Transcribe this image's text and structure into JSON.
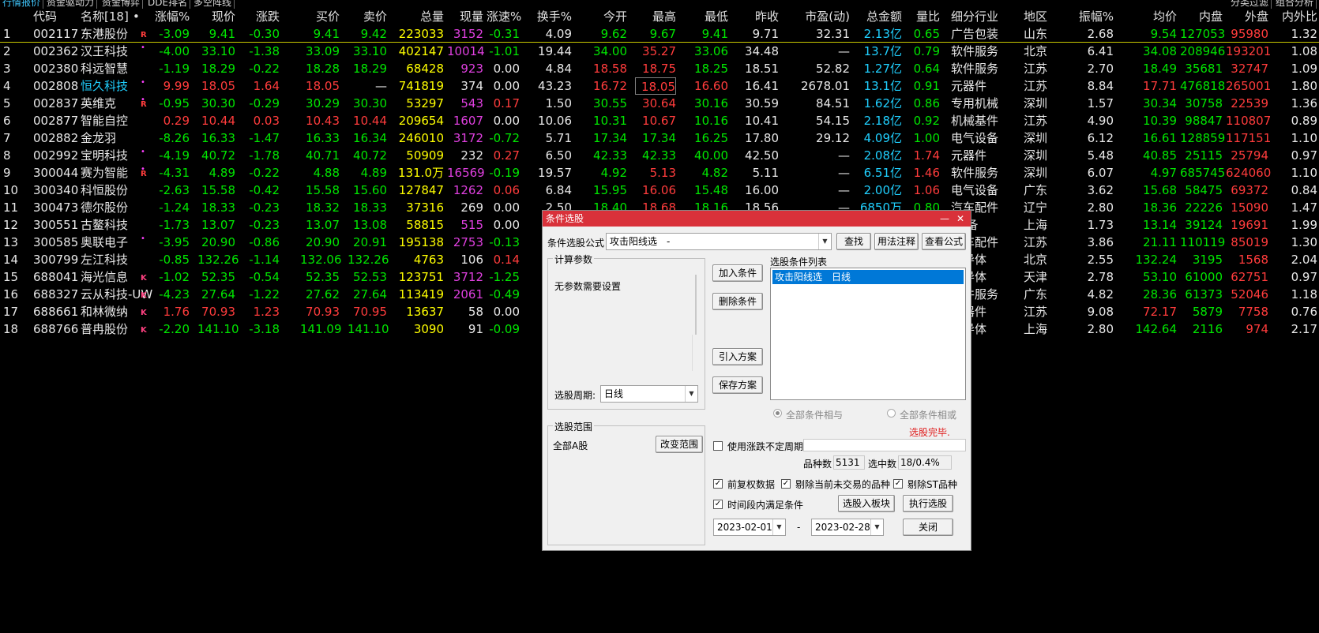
{
  "top_tabs": [
    {
      "label": "行情报价"
    },
    {
      "label": "资金驱动力"
    },
    {
      "label": "资金博弈"
    },
    {
      "label": "DDE排名"
    },
    {
      "label": "多空阵线"
    },
    {
      "label": "分类过滤"
    },
    {
      "label": "组合分析"
    }
  ],
  "table": {
    "headers": [
      "代码",
      "名称[18]",
      "•",
      "涨幅%",
      "现价",
      "涨跌",
      "买价",
      "卖价",
      "总量",
      "现量",
      "涨速%",
      "换手%",
      "今开",
      "最高",
      "最低",
      "昨收",
      "市盈(动)",
      "总金额",
      "量比",
      "细分行业",
      "地区",
      "振幅%",
      "均价",
      "内盘",
      "外盘",
      "内外比"
    ],
    "rows": [
      {
        "idx": "1",
        "code": "002117",
        "name": "东港股份",
        "dot": "",
        "flag": "R",
        "pct": "-3.09",
        "price": "9.41",
        "chg": "-0.30",
        "bid": "9.41",
        "ask": "9.42",
        "vol": "223033",
        "cur": "3152",
        "speed": "-0.31",
        "turn": "4.09",
        "open": "9.62",
        "high": "9.67",
        "low": "9.41",
        "prev": "9.71",
        "pe": "32.31",
        "amount": "2.13亿",
        "vr": "0.65",
        "industry": "广告包装",
        "region": "山东",
        "amp": "2.68",
        "avg": "9.54",
        "inner": "127053",
        "outer": "95980",
        "io": "1.32"
      },
      {
        "idx": "2",
        "code": "002362",
        "name": "汉王科技",
        "dot": "•",
        "flag": "",
        "pct": "-4.00",
        "price": "33.10",
        "chg": "-1.38",
        "bid": "33.09",
        "ask": "33.10",
        "vol": "402147",
        "cur": "10014",
        "speed": "-1.01",
        "turn": "19.44",
        "open": "34.00",
        "high": "35.27",
        "low": "33.06",
        "prev": "34.48",
        "pe": "—",
        "amount": "13.7亿",
        "vr": "0.79",
        "industry": "软件服务",
        "region": "北京",
        "amp": "6.41",
        "avg": "34.08",
        "inner": "208946",
        "outer": "193201",
        "io": "1.08"
      },
      {
        "idx": "3",
        "code": "002380",
        "name": "科远智慧",
        "dot": "",
        "flag": "",
        "pct": "-1.19",
        "price": "18.29",
        "chg": "-0.22",
        "bid": "18.28",
        "ask": "18.29",
        "vol": "68428",
        "cur": "923",
        "speed": "0.00",
        "turn": "4.84",
        "open": "18.58",
        "high": "18.75",
        "low": "18.25",
        "prev": "18.51",
        "pe": "52.82",
        "amount": "1.27亿",
        "vr": "0.64",
        "industry": "软件服务",
        "region": "江苏",
        "amp": "2.70",
        "avg": "18.49",
        "inner": "35681",
        "outer": "32747",
        "io": "1.09"
      },
      {
        "idx": "4",
        "code": "002808",
        "name": "恒久科技",
        "dot": "•",
        "flag": "",
        "pct": "9.99",
        "price": "18.05",
        "chg": "1.64",
        "bid": "18.05",
        "ask": "—",
        "vol": "741819",
        "cur": "374",
        "speed": "0.00",
        "turn": "43.23",
        "open": "16.72",
        "high": "18.05",
        "low": "16.60",
        "prev": "16.41",
        "pe": "2678.01",
        "amount": "13.1亿",
        "vr": "0.91",
        "industry": "元器件",
        "region": "江苏",
        "amp": "8.84",
        "avg": "17.71",
        "inner": "476818",
        "outer": "265001",
        "io": "1.80"
      },
      {
        "idx": "5",
        "code": "002837",
        "name": "英维克",
        "dot": "•",
        "flag": "R",
        "pct": "-0.95",
        "price": "30.30",
        "chg": "-0.29",
        "bid": "30.29",
        "ask": "30.30",
        "vol": "53297",
        "cur": "543",
        "speed": "0.17",
        "turn": "1.50",
        "open": "30.55",
        "high": "30.64",
        "low": "30.16",
        "prev": "30.59",
        "pe": "84.51",
        "amount": "1.62亿",
        "vr": "0.86",
        "industry": "专用机械",
        "region": "深圳",
        "amp": "1.57",
        "avg": "30.34",
        "inner": "30758",
        "outer": "22539",
        "io": "1.36"
      },
      {
        "idx": "6",
        "code": "002877",
        "name": "智能自控",
        "dot": "",
        "flag": "",
        "pct": "0.29",
        "price": "10.44",
        "chg": "0.03",
        "bid": "10.43",
        "ask": "10.44",
        "vol": "209654",
        "cur": "1607",
        "speed": "0.00",
        "turn": "10.06",
        "open": "10.31",
        "high": "10.67",
        "low": "10.16",
        "prev": "10.41",
        "pe": "54.15",
        "amount": "2.18亿",
        "vr": "0.92",
        "industry": "机械基件",
        "region": "江苏",
        "amp": "4.90",
        "avg": "10.39",
        "inner": "98847",
        "outer": "110807",
        "io": "0.89"
      },
      {
        "idx": "7",
        "code": "002882",
        "name": "金龙羽",
        "dot": "",
        "flag": "",
        "pct": "-8.26",
        "price": "16.33",
        "chg": "-1.47",
        "bid": "16.33",
        "ask": "16.34",
        "vol": "246010",
        "cur": "3172",
        "speed": "-0.72",
        "turn": "5.71",
        "open": "17.34",
        "high": "17.34",
        "low": "16.25",
        "prev": "17.80",
        "pe": "29.12",
        "amount": "4.09亿",
        "vr": "1.00",
        "industry": "电气设备",
        "region": "深圳",
        "amp": "6.12",
        "avg": "16.61",
        "inner": "128859",
        "outer": "117151",
        "io": "1.10"
      },
      {
        "idx": "8",
        "code": "002992",
        "name": "宝明科技",
        "dot": "•",
        "flag": "",
        "pct": "-4.19",
        "price": "40.72",
        "chg": "-1.78",
        "bid": "40.71",
        "ask": "40.72",
        "vol": "50909",
        "cur": "232",
        "speed": "0.27",
        "turn": "6.50",
        "open": "42.33",
        "high": "42.33",
        "low": "40.00",
        "prev": "42.50",
        "pe": "—",
        "amount": "2.08亿",
        "vr": "1.74",
        "industry": "元器件",
        "region": "深圳",
        "amp": "5.48",
        "avg": "40.85",
        "inner": "25115",
        "outer": "25794",
        "io": "0.97"
      },
      {
        "idx": "9",
        "code": "300044",
        "name": "赛为智能",
        "dot": "•",
        "flag": "R",
        "pct": "-4.31",
        "price": "4.89",
        "chg": "-0.22",
        "bid": "4.88",
        "ask": "4.89",
        "vol": "131.0万",
        "cur": "16569",
        "speed": "-0.19",
        "turn": "19.57",
        "open": "4.92",
        "high": "5.13",
        "low": "4.82",
        "prev": "5.11",
        "pe": "—",
        "amount": "6.51亿",
        "vr": "1.46",
        "industry": "软件服务",
        "region": "深圳",
        "amp": "6.07",
        "avg": "4.97",
        "inner": "685745",
        "outer": "624060",
        "io": "1.10"
      },
      {
        "idx": "10",
        "code": "300340",
        "name": "科恒股份",
        "dot": "",
        "flag": "",
        "pct": "-2.63",
        "price": "15.58",
        "chg": "-0.42",
        "bid": "15.58",
        "ask": "15.60",
        "vol": "127847",
        "cur": "1262",
        "speed": "0.06",
        "turn": "6.84",
        "open": "15.95",
        "high": "16.06",
        "low": "15.48",
        "prev": "16.00",
        "pe": "—",
        "amount": "2.00亿",
        "vr": "1.06",
        "industry": "电气设备",
        "region": "广东",
        "amp": "3.62",
        "avg": "15.68",
        "inner": "58475",
        "outer": "69372",
        "io": "0.84"
      },
      {
        "idx": "11",
        "code": "300473",
        "name": "德尔股份",
        "dot": "",
        "flag": "",
        "pct": "-1.24",
        "price": "18.33",
        "chg": "-0.23",
        "bid": "18.32",
        "ask": "18.33",
        "vol": "37316",
        "cur": "269",
        "speed": "0.00",
        "turn": "2.50",
        "open": "18.40",
        "high": "18.68",
        "low": "18.16",
        "prev": "18.56",
        "pe": "—",
        "amount": "6850万",
        "vr": "0.80",
        "industry": "汽车配件",
        "region": "辽宁",
        "amp": "2.80",
        "avg": "18.36",
        "inner": "22226",
        "outer": "15090",
        "io": "1.47"
      },
      {
        "idx": "12",
        "code": "300551",
        "name": "古鳌科技",
        "dot": "",
        "flag": "",
        "pct": "-1.73",
        "price": "13.07",
        "chg": "-0.23",
        "bid": "13.07",
        "ask": "13.08",
        "vol": "58815",
        "cur": "515",
        "speed": "0.00",
        "turn": "",
        "open": "",
        "high": "",
        "low": "",
        "prev": "",
        "pe": "",
        "amount": "",
        "vr": "",
        "industry": "I设备",
        "region": "上海",
        "amp": "1.73",
        "avg": "13.14",
        "inner": "39124",
        "outer": "19691",
        "io": "1.99"
      },
      {
        "idx": "13",
        "code": "300585",
        "name": "奥联电子",
        "dot": "•",
        "flag": "",
        "pct": "-3.95",
        "price": "20.90",
        "chg": "-0.86",
        "bid": "20.90",
        "ask": "20.91",
        "vol": "195138",
        "cur": "2753",
        "speed": "-0.13",
        "turn": "",
        "open": "",
        "high": "",
        "low": "",
        "prev": "",
        "pe": "",
        "amount": "",
        "vr": "",
        "industry": "汽车配件",
        "region": "江苏",
        "amp": "3.86",
        "avg": "21.11",
        "inner": "110119",
        "outer": "85019",
        "io": "1.30"
      },
      {
        "idx": "14",
        "code": "300799",
        "name": "左江科技",
        "dot": "",
        "flag": "",
        "pct": "-0.85",
        "price": "132.26",
        "chg": "-1.14",
        "bid": "132.06",
        "ask": "132.26",
        "vol": "4763",
        "cur": "106",
        "speed": "0.14",
        "turn": "",
        "open": "",
        "high": "",
        "low": "",
        "prev": "",
        "pe": "",
        "amount": "",
        "vr": "",
        "industry": "半导体",
        "region": "北京",
        "amp": "2.55",
        "avg": "132.24",
        "inner": "3195",
        "outer": "1568",
        "io": "2.04"
      },
      {
        "idx": "15",
        "code": "688041",
        "name": "海光信息",
        "dot": "",
        "flag": "K",
        "pct": "-1.02",
        "price": "52.35",
        "chg": "-0.54",
        "bid": "52.35",
        "ask": "52.53",
        "vol": "123751",
        "cur": "3712",
        "speed": "-1.25",
        "turn": "",
        "open": "",
        "high": "",
        "low": "",
        "prev": "",
        "pe": "",
        "amount": "",
        "vr": "",
        "industry": "半导体",
        "region": "天津",
        "amp": "2.78",
        "avg": "53.10",
        "inner": "61000",
        "outer": "62751",
        "io": "0.97"
      },
      {
        "idx": "16",
        "code": "688327",
        "name": "云从科技-UW",
        "dot": "",
        "flag": "K",
        "pct": "-4.23",
        "price": "27.64",
        "chg": "-1.22",
        "bid": "27.62",
        "ask": "27.64",
        "vol": "113419",
        "cur": "2061",
        "speed": "-0.49",
        "turn": "",
        "open": "",
        "high": "",
        "low": "",
        "prev": "",
        "pe": "",
        "amount": "",
        "vr": "",
        "industry": "软件服务",
        "region": "广东",
        "amp": "4.82",
        "avg": "28.36",
        "inner": "61373",
        "outer": "52046",
        "io": "1.18"
      },
      {
        "idx": "17",
        "code": "688661",
        "name": "和林微纳",
        "dot": "",
        "flag": "K",
        "pct": "1.76",
        "price": "70.93",
        "chg": "1.23",
        "bid": "70.93",
        "ask": "70.95",
        "vol": "13637",
        "cur": "58",
        "speed": "0.00",
        "turn": "",
        "open": "",
        "high": "",
        "low": "",
        "prev": "",
        "pe": "",
        "amount": "",
        "vr": "",
        "industry": "元器件",
        "region": "江苏",
        "amp": "9.08",
        "avg": "72.17",
        "inner": "5879",
        "outer": "7758",
        "io": "0.76"
      },
      {
        "idx": "18",
        "code": "688766",
        "name": "普冉股份",
        "dot": "",
        "flag": "K",
        "pct": "-2.20",
        "price": "141.10",
        "chg": "-3.18",
        "bid": "141.09",
        "ask": "141.10",
        "vol": "3090",
        "cur": "91",
        "speed": "-0.09",
        "turn": "",
        "open": "",
        "high": "",
        "low": "",
        "prev": "",
        "pe": "",
        "amount": "",
        "vr": "",
        "industry": "半导体",
        "region": "上海",
        "amp": "2.80",
        "avg": "142.64",
        "inner": "2116",
        "outer": "974",
        "io": "2.17"
      }
    ]
  },
  "dialog": {
    "title": "条件选股",
    "formula_label": "条件选股公式",
    "formula_value": "攻击阳线选　-",
    "find_button": "查找",
    "usage_button": "用法注释",
    "view_button": "查看公式",
    "params_group": "计算参数",
    "params_text": "无参数需要设置",
    "add_button": "加入条件",
    "delete_button": "删除条件",
    "import_button": "引入方案",
    "save_button": "保存方案",
    "list_label": "选股条件列表",
    "list_items": [
      "攻击阳线选　日线"
    ],
    "period_label": "选股周期:",
    "period_value": "日线",
    "radio_and": "全部条件相与",
    "radio_or": "全部条件相或",
    "status_text": "选股完毕.",
    "scope_group": "选股范围",
    "scope_value": "全部A股",
    "change_scope_button": "改变范围",
    "use_period_label": "使用涨跌不定周期",
    "count_label": "品种数",
    "count_value": "5131",
    "selected_label": "选中数",
    "selected_value": "18/0.4%",
    "cb_prior": "前复权数据",
    "cb_exclude_notrade": "剔除当前未交易的品种",
    "cb_exclude_st": "剔除ST品种",
    "cb_time_range": "时间段内满足条件",
    "to_block_button": "选股入板块",
    "run_button": "执行选股",
    "date_from": "2023-02-01",
    "date_sep": "-",
    "date_to": "2023-02-28",
    "close_button": "关闭"
  },
  "colors": {
    "up": "#ff3c3c",
    "down": "#00e600",
    "title_bar": "#d9313a",
    "selection": "#0078d7"
  }
}
